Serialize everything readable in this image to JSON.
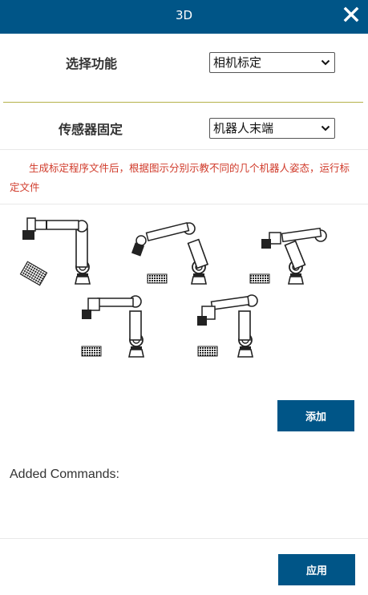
{
  "window": {
    "title": "3D",
    "close_icon": "close-icon"
  },
  "function_row": {
    "label": "选择功能",
    "selected": "相机标定"
  },
  "sensor_row": {
    "label": "传感器固定",
    "selected": "机器人末端"
  },
  "notice": "生成标定程序文件后，根据图示分别示教不同的几个机器人姿态，运行标定文件",
  "add_button": "添加",
  "added_commands_label": "Added Commands:",
  "apply_button": "应用",
  "colors": {
    "header": "#005587",
    "notice": "#d03a2a",
    "divider": "#b5b24a"
  }
}
